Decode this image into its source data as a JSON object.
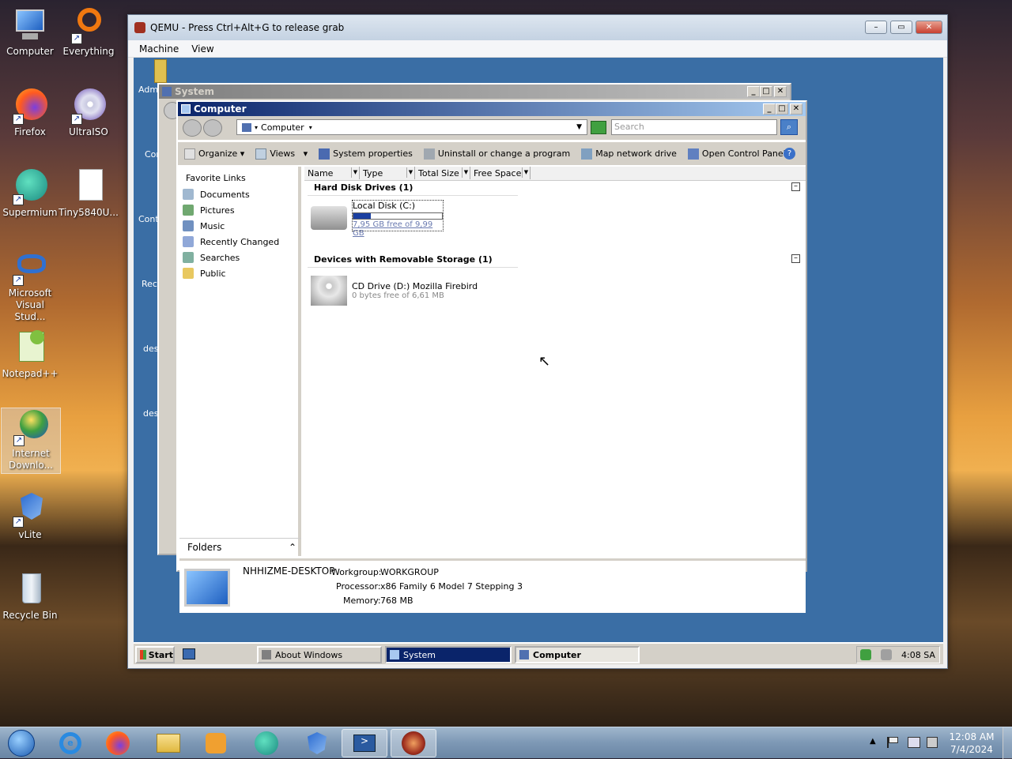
{
  "desktop": {
    "icons": [
      {
        "label": "Computer"
      },
      {
        "label": "Everything"
      },
      {
        "label": "Firefox"
      },
      {
        "label": "UltraISO"
      },
      {
        "label": "Supermium"
      },
      {
        "label": "Tiny5840U..."
      },
      {
        "label": "Microsoft Visual Stud..."
      },
      {
        "label": "Notepad++"
      },
      {
        "label": "Internet Downlo..."
      },
      {
        "label": "vLite"
      },
      {
        "label": "Recycle Bin"
      }
    ]
  },
  "host_taskbar": {
    "clock_time": "12:08 AM",
    "clock_date": "7/4/2024",
    "items": [
      "start-orb-icon",
      "internet-explorer-icon",
      "firefox-icon",
      "file-explorer-icon",
      "media-player-icon",
      "supermium-icon",
      "vlite-icon",
      "powershell-icon",
      "qemu-icon"
    ]
  },
  "qemu": {
    "title": "QEMU - Press Ctrl+Alt+G to release grab",
    "menu": [
      "Machine",
      "View"
    ]
  },
  "guest": {
    "side_labels": [
      "Admi",
      "Com",
      "Cont",
      "Rec",
      "des",
      "desk"
    ],
    "system_window": {
      "title": "System"
    },
    "computer_window": {
      "title": "Computer",
      "address": "Computer",
      "search_placeholder": "Search",
      "toolbar": [
        "Organize",
        "Views",
        "System properties",
        "Uninstall or change a program",
        "Map network drive",
        "Open Control Panel"
      ],
      "favorite_links_header": "Favorite Links",
      "favorites": [
        "Documents",
        "Pictures",
        "Music",
        "Recently Changed",
        "Searches",
        "Public"
      ],
      "folders_label": "Folders",
      "columns": [
        "Name",
        "Type",
        "Total Size",
        "Free Space"
      ],
      "groups": [
        {
          "title": "Hard Disk Drives (1)",
          "items": [
            {
              "name": "Local Disk (C:)",
              "detail": "7,95 GB free of 9,99 GB",
              "used_fraction": 0.2
            }
          ]
        },
        {
          "title": "Devices with Removable Storage (1)",
          "items": [
            {
              "name": "CD Drive (D:) Mozilla Firebird",
              "detail": "0 bytes free of 6,61 MB"
            }
          ]
        }
      ],
      "details": {
        "computer_name": "NHHIZME-DESKTOP",
        "workgroup_label": "Workgroup:",
        "workgroup": "WORKGROUP",
        "processor_label": "Processor:",
        "processor": "x86 Family 6 Model 7 Stepping 3",
        "memory_label": "Memory:",
        "memory": "768 MB"
      }
    },
    "taskbar": {
      "start": "Start",
      "buttons": [
        "About Windows",
        "System",
        "Computer"
      ],
      "clock": "4:08 SA"
    }
  }
}
